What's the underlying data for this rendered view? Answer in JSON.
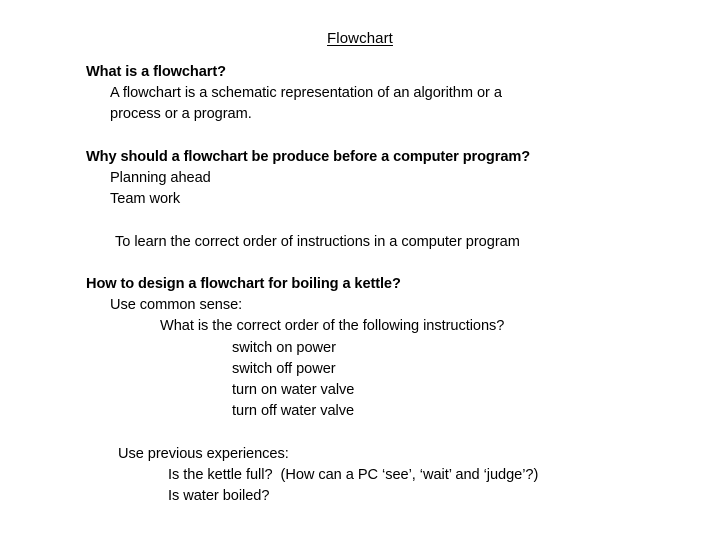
{
  "slide": {
    "title": "Flowchart",
    "sections": [
      {
        "heading": "What is a flowchart?",
        "lines": [
          "A flowchart is a schematic representation of an algorithm or a",
          "process or a program."
        ]
      },
      {
        "heading": "Why should a flowchart be produce before a computer program?",
        "lines": [
          "Planning ahead",
          "Team work",
          "To learn the correct order of instructions in a computer program"
        ]
      },
      {
        "heading": "How to design a flowchart for boiling a kettle?",
        "lines": [
          "Use common sense:",
          "What is the correct order of the following instructions?",
          "switch on power",
          "switch off power",
          "turn on water valve",
          "turn off water valve",
          "Use previous experiences:",
          "Is the kettle full?  (How can a PC ‘see’, ‘wait’ and ‘judge’?)",
          "Is water boiled?"
        ]
      }
    ]
  },
  "colors": {
    "background": "#ffffff",
    "text": "#000000"
  }
}
